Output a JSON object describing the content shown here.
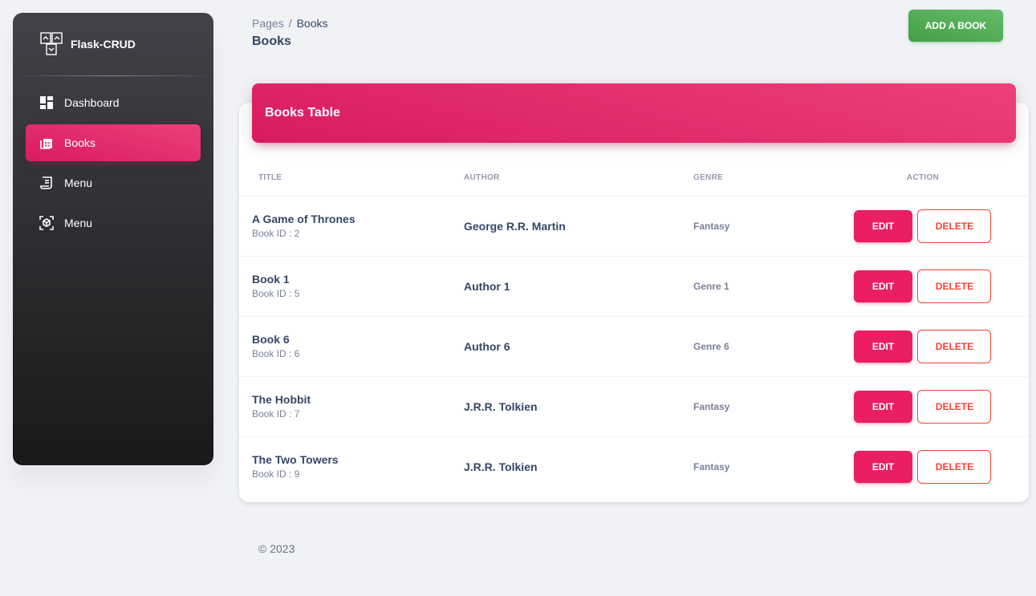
{
  "sidebar": {
    "brand": "Flask-CRUD",
    "items": [
      {
        "label": "Dashboard",
        "icon": "dashboard-icon",
        "active": false
      },
      {
        "label": "Books",
        "icon": "books-icon",
        "active": true
      },
      {
        "label": "Menu",
        "icon": "receipt-icon",
        "active": false
      },
      {
        "label": "Menu",
        "icon": "view-in-ar-icon",
        "active": false
      }
    ]
  },
  "header": {
    "breadcrumb_root": "Pages",
    "breadcrumb_sep": "/",
    "breadcrumb_current": "Books",
    "title": "Books",
    "add_button": "ADD A BOOK"
  },
  "table": {
    "title": "Books Table",
    "columns": [
      "TITLE",
      "AUTHOR",
      "GENRE",
      "ACTION"
    ],
    "rows": [
      {
        "title": "A Game of Thrones",
        "book_id": "Book ID : 2",
        "author": "George R.R. Martin",
        "genre": "Fantasy"
      },
      {
        "title": "Book 1",
        "book_id": "Book ID : 5",
        "author": "Author 1",
        "genre": "Genre 1"
      },
      {
        "title": "Book 6",
        "book_id": "Book ID : 6",
        "author": "Author 6",
        "genre": "Genre 6"
      },
      {
        "title": "The Hobbit",
        "book_id": "Book ID : 7",
        "author": "J.R.R. Tolkien",
        "genre": "Fantasy"
      },
      {
        "title": "The Two Towers",
        "book_id": "Book ID : 9",
        "author": "J.R.R. Tolkien",
        "genre": "Fantasy"
      }
    ],
    "edit_label": "EDIT",
    "delete_label": "DELETE"
  },
  "footer": {
    "copyright": "© 2023"
  },
  "colors": {
    "primary": "#e91e63",
    "success": "#4caf50",
    "danger": "#f44335",
    "sidebar_dark": "#191919"
  }
}
